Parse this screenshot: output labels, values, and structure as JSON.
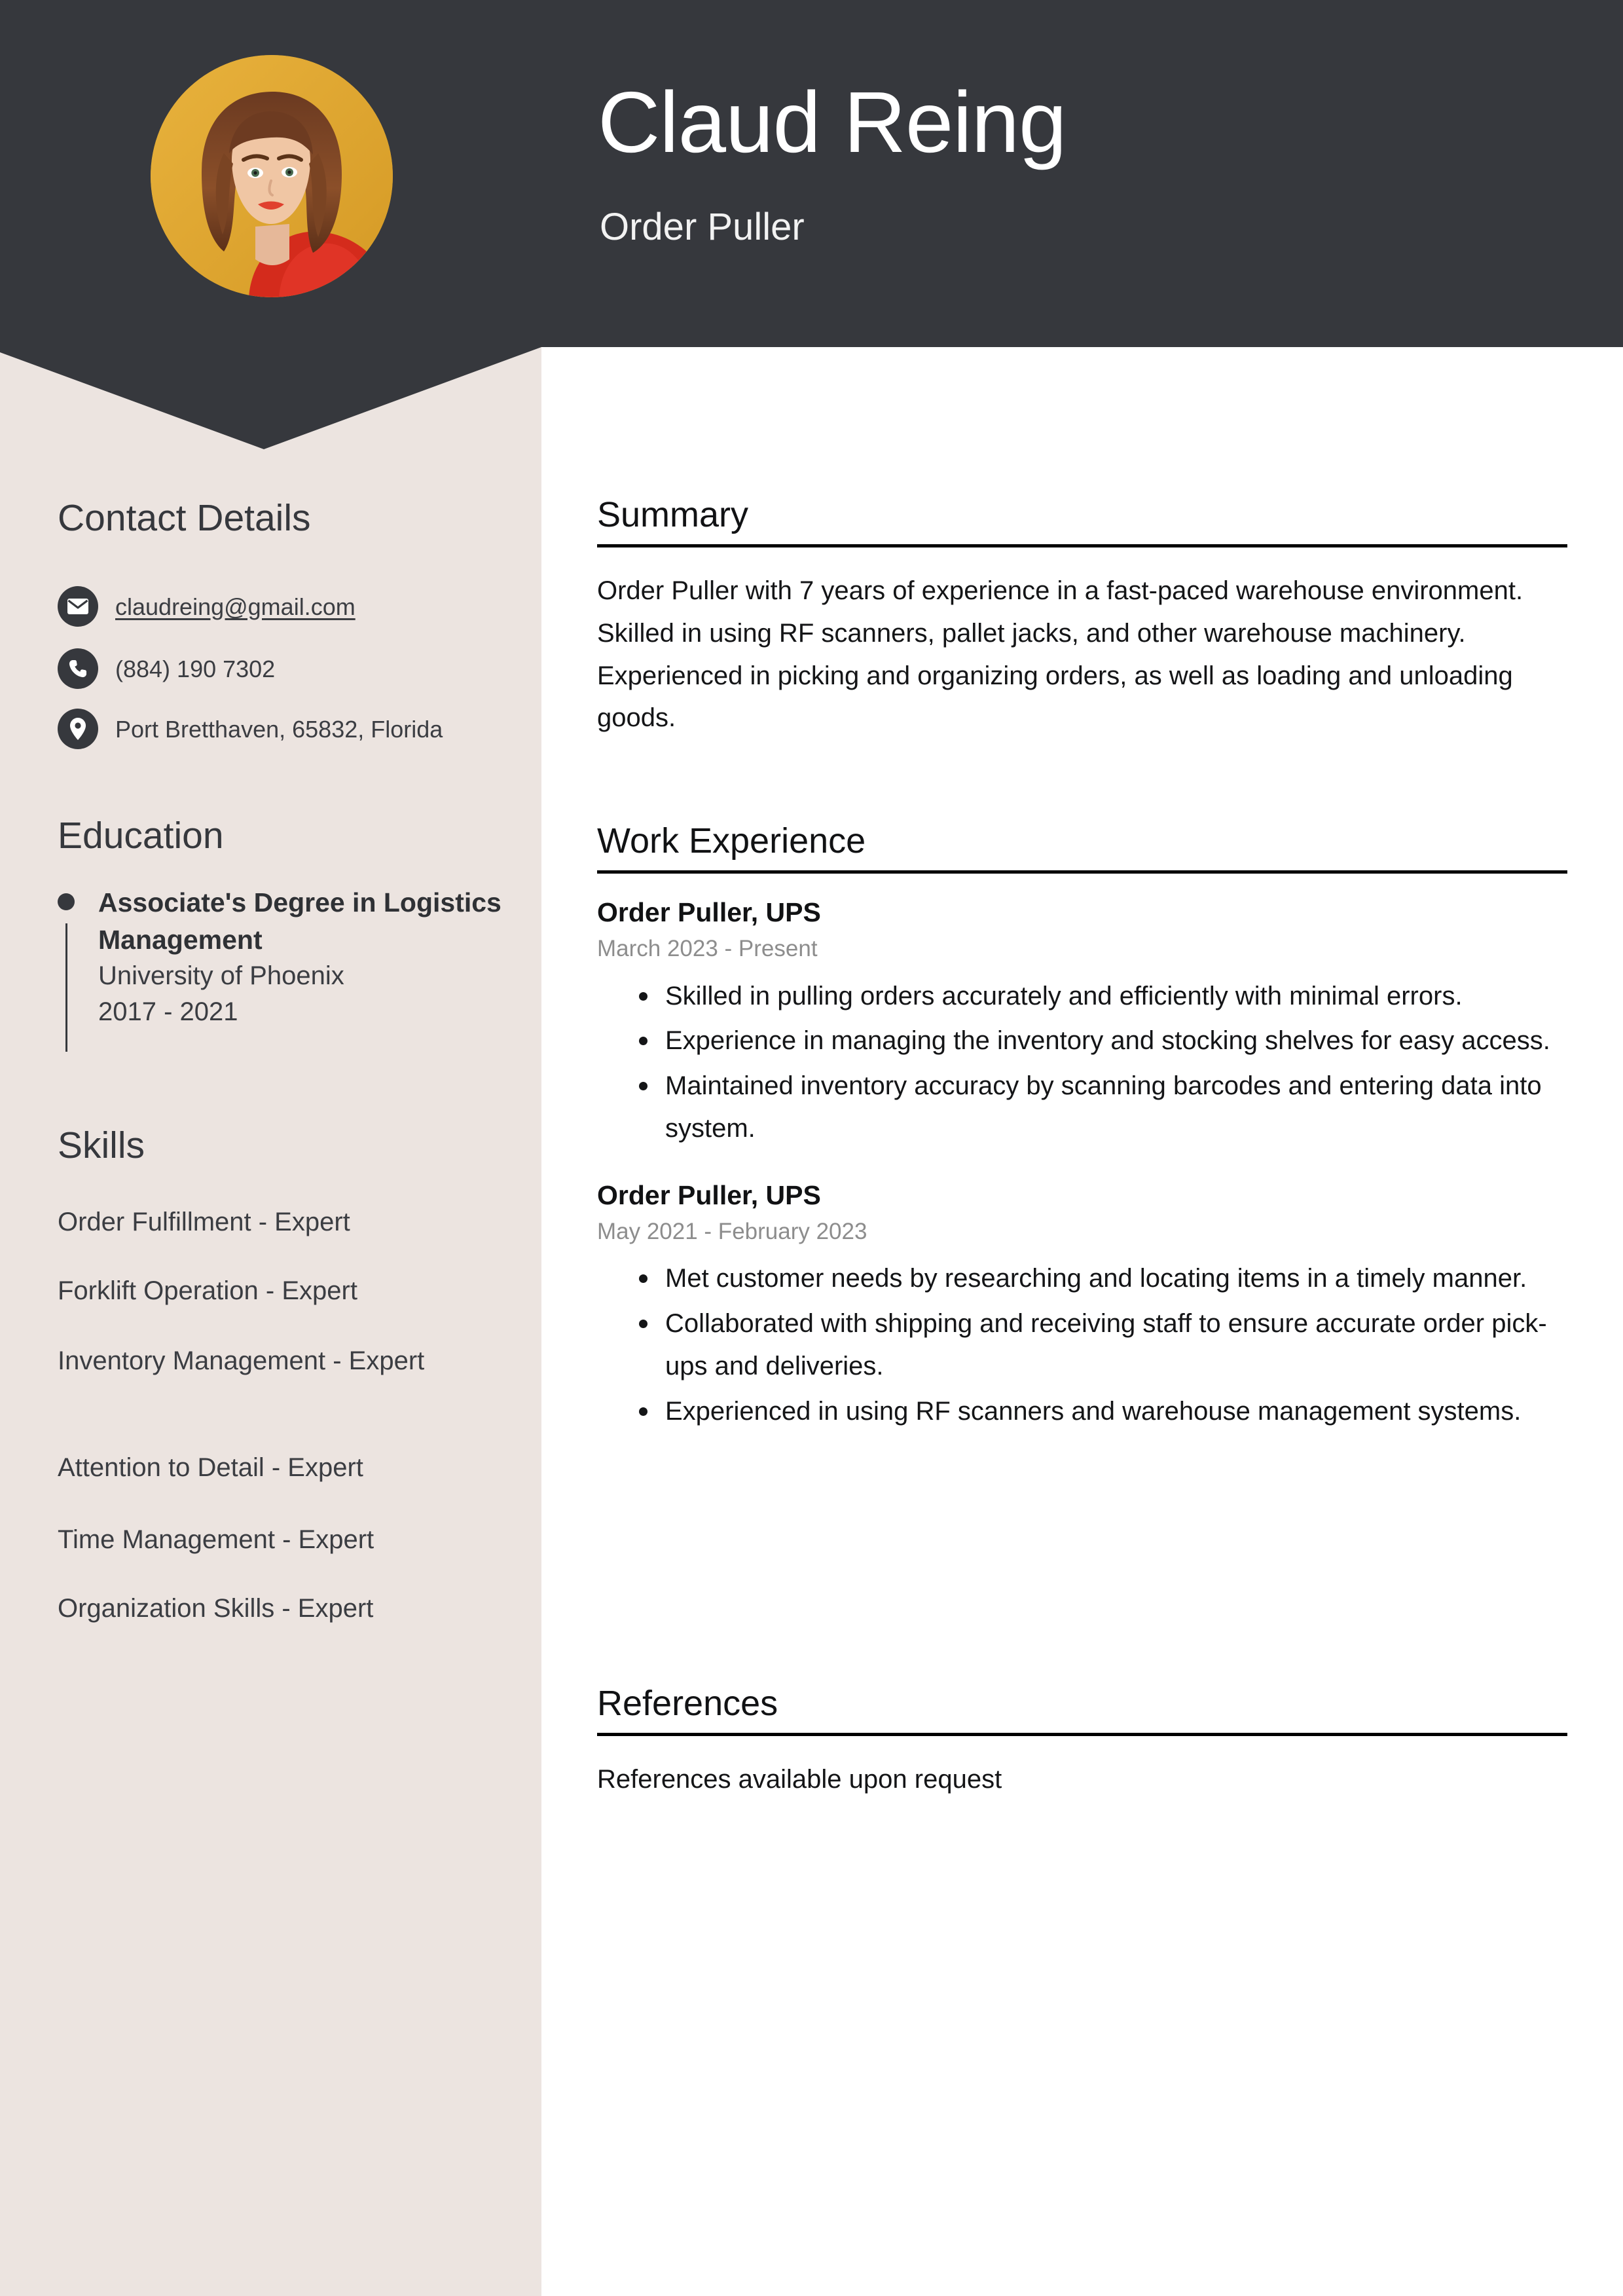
{
  "colors": {
    "header_bg": "#36383d",
    "sidebar_bg": "#ece4e0",
    "main_bg": "#ffffff",
    "accent_dark": "#36383d",
    "avatar_bg": "#e0a933",
    "muted_text": "#8d8d8d",
    "rule": "#000000"
  },
  "header": {
    "name": "Claud Reing",
    "role": "Order Puller",
    "avatar_alt": "profile-photo"
  },
  "sidebar": {
    "contact": {
      "heading": "Contact Details",
      "items": [
        {
          "icon": "envelope-icon",
          "text": "claudreing@gmail.com",
          "is_link": true
        },
        {
          "icon": "phone-icon",
          "text": "(884) 190 7302",
          "is_link": false
        },
        {
          "icon": "location-pin-icon",
          "text": "Port Bretthaven, 65832, Florida",
          "is_link": false
        }
      ]
    },
    "education": {
      "heading": "Education",
      "entries": [
        {
          "degree": "Associate's Degree in Logistics Management",
          "school": "University of Phoenix",
          "dates": "2017 - 2021"
        }
      ]
    },
    "skills": {
      "heading": "Skills",
      "items": [
        "Order Fulfillment - Expert",
        "Forklift Operation - Expert",
        "Inventory Management - Expert",
        "Attention to Detail - Expert",
        "Time Management - Expert",
        "Organization Skills - Expert"
      ]
    }
  },
  "main": {
    "summary": {
      "heading": "Summary",
      "text": "Order Puller with 7 years of experience in a fast-paced warehouse environment. Skilled in using RF scanners, pallet jacks, and other warehouse machinery. Experienced in picking and organizing orders, as well as loading and unloading goods."
    },
    "work": {
      "heading": "Work Experience",
      "jobs": [
        {
          "title": "Order Puller, UPS",
          "dates": "March 2023 - Present",
          "bullets": [
            "Skilled in pulling orders accurately and efficiently with minimal errors.",
            "Experience in managing the inventory and stocking shelves for easy access.",
            "Maintained inventory accuracy by scanning barcodes and entering data into system."
          ]
        },
        {
          "title": "Order Puller, UPS",
          "dates": "May 2021 - February 2023",
          "bullets": [
            "Met customer needs by researching and locating items in a timely manner.",
            "Collaborated with shipping and receiving staff to ensure accurate order pick-ups and deliveries.",
            "Experienced in using RF scanners and warehouse management systems."
          ]
        }
      ]
    },
    "references": {
      "heading": "References",
      "text": "References available upon request"
    }
  }
}
